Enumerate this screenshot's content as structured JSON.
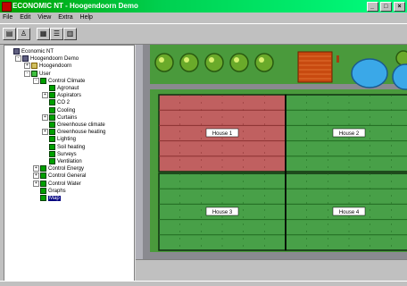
{
  "window": {
    "title": "ECONOMIC NT - Hoogendoorn Demo",
    "controls": [
      "_",
      "□",
      "×"
    ]
  },
  "menu": [
    "File",
    "Edit",
    "View",
    "Extra",
    "Help"
  ],
  "toolbar": {
    "buttons": [
      {
        "name": "save-tool-button",
        "glyph": "▤"
      },
      {
        "name": "user-tool-button",
        "glyph": "♙"
      },
      {
        "name": "tree-tool-button",
        "glyph": "▦"
      },
      {
        "name": "list-tool-button",
        "glyph": "☰"
      },
      {
        "name": "grid-tool-button",
        "glyph": "▥"
      }
    ]
  },
  "tree": [
    {
      "label": "Economic NT",
      "indent": 0,
      "icon": "pc",
      "exp": ""
    },
    {
      "label": "Hoogendoorn Demo",
      "indent": 1,
      "icon": "pc",
      "exp": "-"
    },
    {
      "label": "Hoogendoorn",
      "indent": 2,
      "icon": "folder",
      "exp": "+"
    },
    {
      "label": "User",
      "indent": 2,
      "icon": "user",
      "exp": "-"
    },
    {
      "label": "Control Climate",
      "indent": 3,
      "icon": "item",
      "exp": "-"
    },
    {
      "label": "Agronaut",
      "indent": 4,
      "icon": "item",
      "exp": ""
    },
    {
      "label": "Aspirators",
      "indent": 4,
      "icon": "item",
      "exp": "+"
    },
    {
      "label": "CO 2",
      "indent": 4,
      "icon": "item",
      "exp": ""
    },
    {
      "label": "Cooling",
      "indent": 4,
      "icon": "item",
      "exp": ""
    },
    {
      "label": "Curtains",
      "indent": 4,
      "icon": "item",
      "exp": "+"
    },
    {
      "label": "Greenhouse climate",
      "indent": 4,
      "icon": "item",
      "exp": ""
    },
    {
      "label": "Greenhouse heating",
      "indent": 4,
      "icon": "item",
      "exp": "+"
    },
    {
      "label": "Lighting",
      "indent": 4,
      "icon": "item",
      "exp": ""
    },
    {
      "label": "Soil heating",
      "indent": 4,
      "icon": "item",
      "exp": ""
    },
    {
      "label": "Surveys",
      "indent": 4,
      "icon": "item",
      "exp": ""
    },
    {
      "label": "Ventilation",
      "indent": 4,
      "icon": "item",
      "exp": ""
    },
    {
      "label": "Control Energy",
      "indent": 3,
      "icon": "item",
      "exp": "+"
    },
    {
      "label": "Control General",
      "indent": 3,
      "icon": "item",
      "exp": "+"
    },
    {
      "label": "Control Water",
      "indent": 3,
      "icon": "item",
      "exp": "+"
    },
    {
      "label": "Graphs",
      "indent": 3,
      "icon": "item",
      "exp": ""
    },
    {
      "label": "Map",
      "indent": 3,
      "icon": "item",
      "exp": "",
      "selected": true
    }
  ],
  "map": {
    "houses": [
      {
        "label": "House 1",
        "color": "#c06060",
        "alarm": true
      },
      {
        "label": "House 2",
        "color": "#48a048",
        "alarm": false
      },
      {
        "label": "House 3",
        "color": "#48a048",
        "alarm": false
      },
      {
        "label": "House 4",
        "color": "#48a048",
        "alarm": false
      }
    ],
    "colors": {
      "background": "#4a9a3c",
      "path": "#8a8a90",
      "tree": "#6aaa2a",
      "shed": "#c84a10",
      "pond": "#3aa8e8",
      "greenhouse": "#48a048",
      "greenhouse_alarm": "#c06060"
    }
  }
}
